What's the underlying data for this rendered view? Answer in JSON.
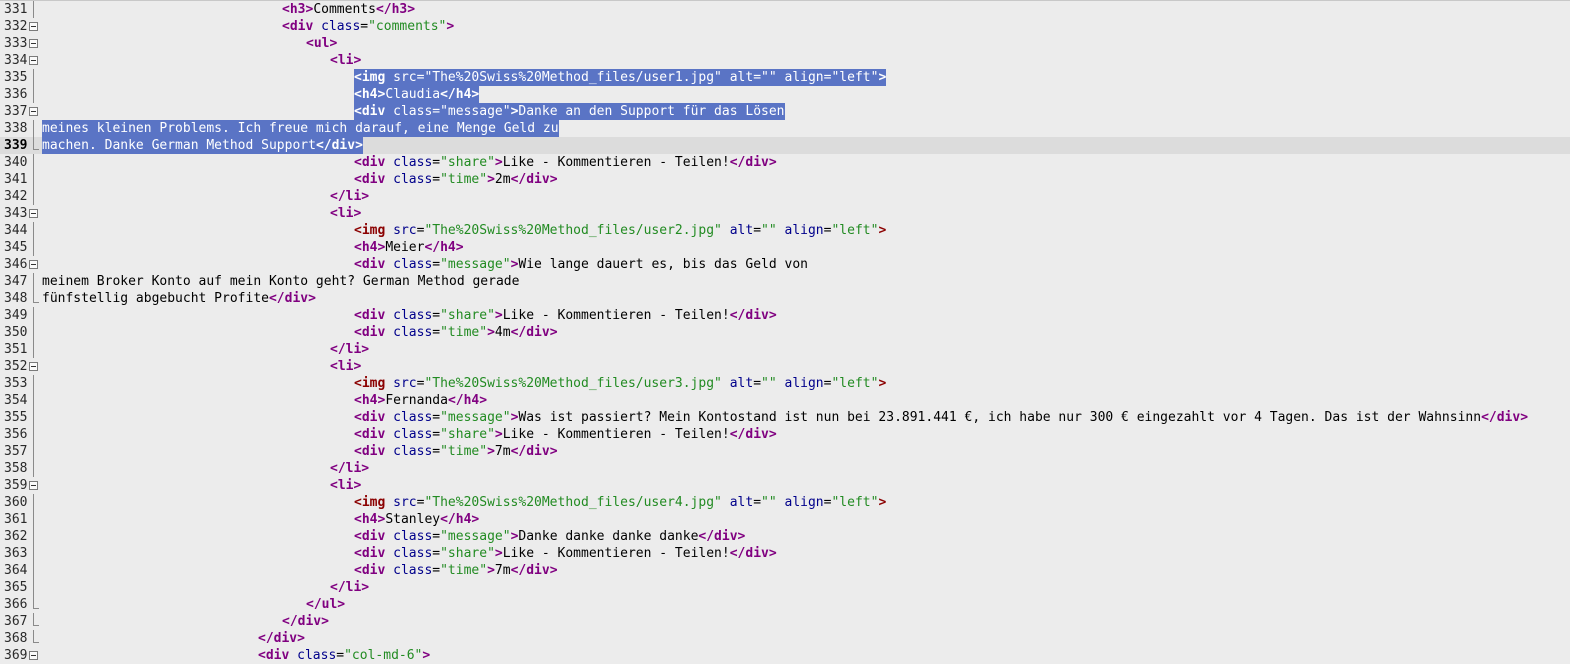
{
  "editor": {
    "lines": [
      {
        "num": "331",
        "indent": 30,
        "fold": "line",
        "tokens": [
          [
            "tag",
            "<h3>"
          ],
          [
            "txt",
            "Comments"
          ],
          [
            "tag",
            "</h3>"
          ]
        ]
      },
      {
        "num": "332",
        "indent": 30,
        "fold": "box",
        "tokens": [
          [
            "tag",
            "<div "
          ],
          [
            "attr",
            "class"
          ],
          [
            "txt",
            "="
          ],
          [
            "str",
            "\"comments\""
          ],
          [
            "tag",
            ">"
          ]
        ]
      },
      {
        "num": "333",
        "indent": 33,
        "fold": "box",
        "tokens": [
          [
            "tag",
            "<ul>"
          ]
        ]
      },
      {
        "num": "334",
        "indent": 36,
        "fold": "box",
        "tokens": [
          [
            "tag",
            "<li>"
          ]
        ]
      },
      {
        "num": "335",
        "indent": 39,
        "fold": "line",
        "selected": true,
        "tokens": [
          [
            "tag-img",
            "<img "
          ],
          [
            "attr",
            "src"
          ],
          [
            "txt",
            "="
          ],
          [
            "str",
            "\"The%20Swiss%20Method_files/user1.jpg\""
          ],
          [
            "txt",
            " "
          ],
          [
            "attr",
            "alt"
          ],
          [
            "txt",
            "="
          ],
          [
            "str",
            "\"\""
          ],
          [
            "txt",
            " "
          ],
          [
            "attr",
            "align"
          ],
          [
            "txt",
            "="
          ],
          [
            "str",
            "\"left\""
          ],
          [
            "tag-img",
            ">"
          ]
        ]
      },
      {
        "num": "336",
        "indent": 39,
        "fold": "line",
        "selected": true,
        "tokens": [
          [
            "tag",
            "<h4>"
          ],
          [
            "txt",
            "Claudia"
          ],
          [
            "tag",
            "</h4>"
          ]
        ]
      },
      {
        "num": "337",
        "indent": 39,
        "fold": "box",
        "selected": true,
        "tokens": [
          [
            "tag",
            "<div "
          ],
          [
            "attr",
            "class"
          ],
          [
            "txt",
            "="
          ],
          [
            "str",
            "\"message\""
          ],
          [
            "tag",
            ">"
          ],
          [
            "txt",
            "Danke an den Support für das Lösen"
          ]
        ]
      },
      {
        "num": "338",
        "indent": 0,
        "fold": "line",
        "selected": true,
        "tokens": [
          [
            "txt",
            "meines kleinen Problems. Ich freue mich darauf, eine Menge Geld zu"
          ]
        ]
      },
      {
        "num": "339",
        "indent": 0,
        "fold": "end",
        "selected": true,
        "current": true,
        "tokens": [
          [
            "txt",
            "machen. Danke German Method Support"
          ],
          [
            "tag",
            "</div>"
          ]
        ]
      },
      {
        "num": "340",
        "indent": 39,
        "fold": "line",
        "tokens": [
          [
            "tag",
            "<div "
          ],
          [
            "attr",
            "class"
          ],
          [
            "txt",
            "="
          ],
          [
            "str",
            "\"share\""
          ],
          [
            "tag",
            ">"
          ],
          [
            "txt",
            "Like - Kommentieren - Teilen!"
          ],
          [
            "tag",
            "</div>"
          ]
        ]
      },
      {
        "num": "341",
        "indent": 39,
        "fold": "line",
        "tokens": [
          [
            "tag",
            "<div "
          ],
          [
            "attr",
            "class"
          ],
          [
            "txt",
            "="
          ],
          [
            "str",
            "\"time\""
          ],
          [
            "tag",
            ">"
          ],
          [
            "txt",
            "2m"
          ],
          [
            "tag",
            "</div>"
          ]
        ]
      },
      {
        "num": "342",
        "indent": 36,
        "fold": "line",
        "tokens": [
          [
            "tag",
            "</li>"
          ]
        ]
      },
      {
        "num": "343",
        "indent": 36,
        "fold": "box",
        "tokens": [
          [
            "tag",
            "<li>"
          ]
        ]
      },
      {
        "num": "344",
        "indent": 39,
        "fold": "line",
        "tokens": [
          [
            "tag-img",
            "<img "
          ],
          [
            "attr",
            "src"
          ],
          [
            "txt",
            "="
          ],
          [
            "str",
            "\"The%20Swiss%20Method_files/user2.jpg\""
          ],
          [
            "txt",
            " "
          ],
          [
            "attr",
            "alt"
          ],
          [
            "txt",
            "="
          ],
          [
            "str",
            "\"\""
          ],
          [
            "txt",
            " "
          ],
          [
            "attr",
            "align"
          ],
          [
            "txt",
            "="
          ],
          [
            "str",
            "\"left\""
          ],
          [
            "tag-img",
            ">"
          ]
        ]
      },
      {
        "num": "345",
        "indent": 39,
        "fold": "line",
        "tokens": [
          [
            "tag",
            "<h4>"
          ],
          [
            "txt",
            "Meier"
          ],
          [
            "tag",
            "</h4>"
          ]
        ]
      },
      {
        "num": "346",
        "indent": 39,
        "fold": "box",
        "tokens": [
          [
            "tag",
            "<div "
          ],
          [
            "attr",
            "class"
          ],
          [
            "txt",
            "="
          ],
          [
            "str",
            "\"message\""
          ],
          [
            "tag",
            ">"
          ],
          [
            "txt",
            "Wie lange dauert es, bis das Geld von"
          ]
        ]
      },
      {
        "num": "347",
        "indent": 0,
        "fold": "line",
        "tokens": [
          [
            "txt",
            "meinem Broker Konto auf mein Konto geht? German Method gerade"
          ]
        ]
      },
      {
        "num": "348",
        "indent": 0,
        "fold": "end",
        "tokens": [
          [
            "txt",
            "fünfstellig abgebucht Profite"
          ],
          [
            "tag",
            "</div>"
          ]
        ]
      },
      {
        "num": "349",
        "indent": 39,
        "fold": "line",
        "tokens": [
          [
            "tag",
            "<div "
          ],
          [
            "attr",
            "class"
          ],
          [
            "txt",
            "="
          ],
          [
            "str",
            "\"share\""
          ],
          [
            "tag",
            ">"
          ],
          [
            "txt",
            "Like - Kommentieren - Teilen!"
          ],
          [
            "tag",
            "</div>"
          ]
        ]
      },
      {
        "num": "350",
        "indent": 39,
        "fold": "line",
        "tokens": [
          [
            "tag",
            "<div "
          ],
          [
            "attr",
            "class"
          ],
          [
            "txt",
            "="
          ],
          [
            "str",
            "\"time\""
          ],
          [
            "tag",
            ">"
          ],
          [
            "txt",
            "4m"
          ],
          [
            "tag",
            "</div>"
          ]
        ]
      },
      {
        "num": "351",
        "indent": 36,
        "fold": "line",
        "tokens": [
          [
            "tag",
            "</li>"
          ]
        ]
      },
      {
        "num": "352",
        "indent": 36,
        "fold": "box",
        "tokens": [
          [
            "tag",
            "<li>"
          ]
        ]
      },
      {
        "num": "353",
        "indent": 39,
        "fold": "line",
        "tokens": [
          [
            "tag-img",
            "<img "
          ],
          [
            "attr",
            "src"
          ],
          [
            "txt",
            "="
          ],
          [
            "str",
            "\"The%20Swiss%20Method_files/user3.jpg\""
          ],
          [
            "txt",
            " "
          ],
          [
            "attr",
            "alt"
          ],
          [
            "txt",
            "="
          ],
          [
            "str",
            "\"\""
          ],
          [
            "txt",
            " "
          ],
          [
            "attr",
            "align"
          ],
          [
            "txt",
            "="
          ],
          [
            "str",
            "\"left\""
          ],
          [
            "tag-img",
            ">"
          ]
        ]
      },
      {
        "num": "354",
        "indent": 39,
        "fold": "line",
        "tokens": [
          [
            "tag",
            "<h4>"
          ],
          [
            "txt",
            "Fernanda"
          ],
          [
            "tag",
            "</h4>"
          ]
        ]
      },
      {
        "num": "355",
        "indent": 39,
        "fold": "line",
        "tokens": [
          [
            "tag",
            "<div "
          ],
          [
            "attr",
            "class"
          ],
          [
            "txt",
            "="
          ],
          [
            "str",
            "\"message\""
          ],
          [
            "tag",
            ">"
          ],
          [
            "txt",
            "Was ist passiert? Mein Kontostand ist nun bei 23.891.441 €, ich habe nur 300 € eingezahlt vor 4 Tagen. Das ist der Wahnsinn"
          ],
          [
            "tag",
            "</div>"
          ]
        ]
      },
      {
        "num": "356",
        "indent": 39,
        "fold": "line",
        "tokens": [
          [
            "tag",
            "<div "
          ],
          [
            "attr",
            "class"
          ],
          [
            "txt",
            "="
          ],
          [
            "str",
            "\"share\""
          ],
          [
            "tag",
            ">"
          ],
          [
            "txt",
            "Like - Kommentieren - Teilen!"
          ],
          [
            "tag",
            "</div>"
          ]
        ]
      },
      {
        "num": "357",
        "indent": 39,
        "fold": "line",
        "tokens": [
          [
            "tag",
            "<div "
          ],
          [
            "attr",
            "class"
          ],
          [
            "txt",
            "="
          ],
          [
            "str",
            "\"time\""
          ],
          [
            "tag",
            ">"
          ],
          [
            "txt",
            "7m"
          ],
          [
            "tag",
            "</div>"
          ]
        ]
      },
      {
        "num": "358",
        "indent": 36,
        "fold": "line",
        "tokens": [
          [
            "tag",
            "</li>"
          ]
        ]
      },
      {
        "num": "359",
        "indent": 36,
        "fold": "box",
        "tokens": [
          [
            "tag",
            "<li>"
          ]
        ]
      },
      {
        "num": "360",
        "indent": 39,
        "fold": "line",
        "tokens": [
          [
            "tag-img",
            "<img "
          ],
          [
            "attr",
            "src"
          ],
          [
            "txt",
            "="
          ],
          [
            "str",
            "\"The%20Swiss%20Method_files/user4.jpg\""
          ],
          [
            "txt",
            " "
          ],
          [
            "attr",
            "alt"
          ],
          [
            "txt",
            "="
          ],
          [
            "str",
            "\"\""
          ],
          [
            "txt",
            " "
          ],
          [
            "attr",
            "align"
          ],
          [
            "txt",
            "="
          ],
          [
            "str",
            "\"left\""
          ],
          [
            "tag-img",
            ">"
          ]
        ]
      },
      {
        "num": "361",
        "indent": 39,
        "fold": "line",
        "tokens": [
          [
            "tag",
            "<h4>"
          ],
          [
            "txt",
            "Stanley"
          ],
          [
            "tag",
            "</h4>"
          ]
        ]
      },
      {
        "num": "362",
        "indent": 39,
        "fold": "line",
        "tokens": [
          [
            "tag",
            "<div "
          ],
          [
            "attr",
            "class"
          ],
          [
            "txt",
            "="
          ],
          [
            "str",
            "\"message\""
          ],
          [
            "tag",
            ">"
          ],
          [
            "txt",
            "Danke danke danke danke"
          ],
          [
            "tag",
            "</div>"
          ]
        ]
      },
      {
        "num": "363",
        "indent": 39,
        "fold": "line",
        "tokens": [
          [
            "tag",
            "<div "
          ],
          [
            "attr",
            "class"
          ],
          [
            "txt",
            "="
          ],
          [
            "str",
            "\"share\""
          ],
          [
            "tag",
            ">"
          ],
          [
            "txt",
            "Like - Kommentieren - Teilen!"
          ],
          [
            "tag",
            "</div>"
          ]
        ]
      },
      {
        "num": "364",
        "indent": 39,
        "fold": "line",
        "tokens": [
          [
            "tag",
            "<div "
          ],
          [
            "attr",
            "class"
          ],
          [
            "txt",
            "="
          ],
          [
            "str",
            "\"time\""
          ],
          [
            "tag",
            ">"
          ],
          [
            "txt",
            "7m"
          ],
          [
            "tag",
            "</div>"
          ]
        ]
      },
      {
        "num": "365",
        "indent": 36,
        "fold": "line",
        "tokens": [
          [
            "tag",
            "</li>"
          ]
        ]
      },
      {
        "num": "366",
        "indent": 33,
        "fold": "end",
        "tokens": [
          [
            "tag",
            "</ul>"
          ]
        ]
      },
      {
        "num": "367",
        "indent": 30,
        "fold": "end",
        "tokens": [
          [
            "tag",
            "</div>"
          ]
        ]
      },
      {
        "num": "368",
        "indent": 27,
        "fold": "end",
        "tokens": [
          [
            "tag",
            "</div>"
          ]
        ]
      },
      {
        "num": "369",
        "indent": 27,
        "fold": "box",
        "tokens": [
          [
            "tag",
            "<div "
          ],
          [
            "attr",
            "class"
          ],
          [
            "txt",
            "="
          ],
          [
            "str",
            "\"col-md-6\""
          ],
          [
            "tag",
            ">"
          ]
        ]
      }
    ]
  }
}
